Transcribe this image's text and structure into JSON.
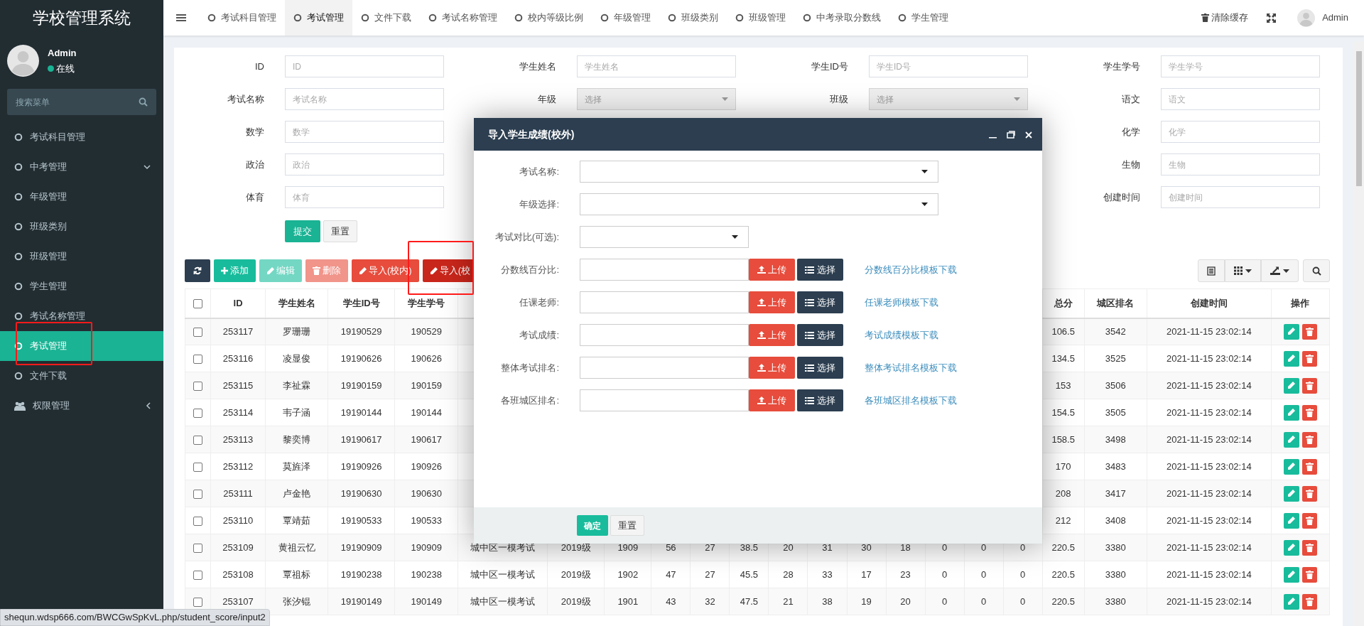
{
  "sidebar": {
    "title": "学校管理系统",
    "user": {
      "name": "Admin",
      "status": "在线",
      "online": true
    },
    "search": {
      "placeholder": "搜索菜单"
    },
    "items": [
      {
        "label": "考试科目管理",
        "kind": "page",
        "selected": false
      },
      {
        "label": "中考管理",
        "kind": "page",
        "selected": false,
        "expanded": true
      },
      {
        "label": "年级管理",
        "kind": "page",
        "selected": false
      },
      {
        "label": "班级类别",
        "kind": "page",
        "selected": false
      },
      {
        "label": "班级管理",
        "kind": "page",
        "selected": false
      },
      {
        "label": "学生管理",
        "kind": "page",
        "selected": false
      },
      {
        "label": "考试名称管理",
        "kind": "page",
        "selected": false
      },
      {
        "label": "考试管理",
        "kind": "page",
        "selected": true
      },
      {
        "label": "文件下载",
        "kind": "page",
        "selected": false
      },
      {
        "label": "权限管理",
        "kind": "module",
        "selected": false,
        "expanded": false
      }
    ]
  },
  "tabs": [
    {
      "label": "考试科目管理",
      "selected": false
    },
    {
      "label": "考试管理",
      "selected": true
    },
    {
      "label": "文件下载",
      "selected": false
    },
    {
      "label": "考试名称管理",
      "selected": false
    },
    {
      "label": "校内等级比例",
      "selected": false
    },
    {
      "label": "年级管理",
      "selected": false
    },
    {
      "label": "班级类别",
      "selected": false
    },
    {
      "label": "班级管理",
      "selected": false
    },
    {
      "label": "中考录取分数线",
      "selected": false
    },
    {
      "label": "学生管理",
      "selected": false
    }
  ],
  "header_right": {
    "clear_cache": "清除缓存",
    "user": "Admin"
  },
  "filter": {
    "rows": [
      [
        {
          "label": "ID",
          "placeholder": "ID",
          "kind": "text"
        },
        {
          "label": "学生姓名",
          "placeholder": "学生姓名",
          "kind": "text"
        },
        {
          "label": "学生ID号",
          "placeholder": "学生ID号",
          "kind": "text"
        },
        {
          "label": "学生学号",
          "placeholder": "学生学号",
          "kind": "text"
        }
      ],
      [
        {
          "label": "考试名称",
          "placeholder": "考试名称",
          "kind": "text"
        },
        {
          "label": "年级",
          "placeholder": "选择",
          "kind": "select"
        },
        {
          "label": "班级",
          "placeholder": "选择",
          "kind": "select"
        },
        {
          "label": "语文",
          "placeholder": "语文",
          "kind": "text"
        }
      ],
      [
        {
          "label": "数学",
          "placeholder": "数学",
          "kind": "text"
        },
        null,
        null,
        {
          "label": "化学",
          "placeholder": "化学",
          "kind": "text"
        }
      ],
      [
        {
          "label": "政治",
          "placeholder": "政治",
          "kind": "text"
        },
        null,
        null,
        {
          "label": "生物",
          "placeholder": "生物",
          "kind": "text"
        }
      ],
      [
        {
          "label": "体育",
          "placeholder": "体育",
          "kind": "text"
        },
        null,
        null,
        {
          "label": "创建时间",
          "placeholder": "创建时间",
          "kind": "text"
        }
      ]
    ],
    "submit": "提交",
    "reset": "重置"
  },
  "toolbar": [
    {
      "kind": "refresh",
      "disabled": false
    },
    {
      "kind": "add",
      "label": "添加",
      "disabled": false
    },
    {
      "kind": "edit",
      "label": "编辑",
      "disabled": true
    },
    {
      "kind": "delete",
      "label": "删除",
      "disabled": true
    },
    {
      "kind": "import",
      "label": "导入(校内)",
      "disabled": false,
      "active": false
    },
    {
      "kind": "import",
      "label": "导入(校",
      "disabled": false,
      "active": true
    }
  ],
  "table": {
    "all_checked": false,
    "columns": [
      "ID",
      "学生姓名",
      "学生ID号",
      "学生学号"
    ],
    "end_columns": [
      "总分",
      "城区排名",
      "创建时间",
      "操作"
    ],
    "rows": [
      {
        "checked": false,
        "cells": [
          "253117",
          "罗珊珊",
          "19190529",
          "190529"
        ],
        "end": [
          "106.5",
          "3542",
          "2021-11-15 23:02:14"
        ]
      },
      {
        "checked": false,
        "cells": [
          "253116",
          "凌显俊",
          "19190626",
          "190626"
        ],
        "end": [
          "134.5",
          "3525",
          "2021-11-15 23:02:14"
        ]
      },
      {
        "checked": false,
        "cells": [
          "253115",
          "李祉霖",
          "19190159",
          "190159"
        ],
        "end": [
          "153",
          "3506",
          "2021-11-15 23:02:14"
        ]
      },
      {
        "checked": false,
        "cells": [
          "253114",
          "韦子涵",
          "19190144",
          "190144"
        ],
        "end": [
          "154.5",
          "3505",
          "2021-11-15 23:02:14"
        ]
      },
      {
        "checked": false,
        "cells": [
          "253113",
          "黎奕博",
          "19190617",
          "190617"
        ],
        "end": [
          "158.5",
          "3498",
          "2021-11-15 23:02:14"
        ]
      },
      {
        "checked": false,
        "cells": [
          "253112",
          "莫旌泽",
          "19190926",
          "190926"
        ],
        "end": [
          "170",
          "3483",
          "2021-11-15 23:02:14"
        ]
      },
      {
        "checked": false,
        "cells": [
          "253111",
          "卢金艳",
          "19190630",
          "190630"
        ],
        "end": [
          "208",
          "3417",
          "2021-11-15 23:02:14"
        ]
      },
      {
        "checked": false,
        "cells": [
          "253110",
          "覃靖茹",
          "19190533",
          "190533"
        ],
        "end": [
          "212",
          "3408",
          "2021-11-15 23:02:14"
        ]
      },
      {
        "checked": false,
        "cells": [
          "253109",
          "黄祖云忆",
          "19190909",
          "190909"
        ],
        "middle": [
          "城中区一模考试",
          "2019级",
          "1909",
          "56",
          "27",
          "38.5",
          "20",
          "31",
          "30",
          "18",
          "0",
          "0",
          "0"
        ],
        "end": [
          "220.5",
          "3380",
          "2021-11-15 23:02:14"
        ]
      },
      {
        "checked": false,
        "cells": [
          "253108",
          "覃祖标",
          "19190238",
          "190238"
        ],
        "middle": [
          "城中区一模考试",
          "2019级",
          "1902",
          "47",
          "27",
          "45.5",
          "28",
          "33",
          "17",
          "23",
          "0",
          "0",
          "0"
        ],
        "end": [
          "220.5",
          "3380",
          "2021-11-15 23:02:14"
        ]
      },
      {
        "checked": false,
        "cells": [
          "253107",
          "张汐锟",
          "19190149",
          "190149"
        ],
        "middle": [
          "城中区一模考试",
          "2019级",
          "1901",
          "43",
          "32",
          "47.5",
          "21",
          "38",
          "19",
          "20",
          "0",
          "0",
          "0"
        ],
        "end": [
          "220.5",
          "3380",
          "2021-11-15 23:02:14"
        ]
      }
    ]
  },
  "modal": {
    "title": "导入学生成绩(校外)",
    "fields": [
      {
        "label": "考试名称:",
        "kind": "select"
      },
      {
        "label": "年级选择:",
        "kind": "select"
      },
      {
        "label": "考试对比(可选):",
        "kind": "select-short"
      },
      {
        "label": "分数线百分比:",
        "kind": "file",
        "upload": "上传",
        "choose": "选择",
        "link": "分数线百分比模板下载"
      },
      {
        "label": "任课老师:",
        "kind": "file",
        "upload": "上传",
        "choose": "选择",
        "link": "任课老师模板下载"
      },
      {
        "label": "考试成绩:",
        "kind": "file",
        "upload": "上传",
        "choose": "选择",
        "link": "考试成绩模板下载"
      },
      {
        "label": "整体考试排名:",
        "kind": "file",
        "upload": "上传",
        "choose": "选择",
        "link": "整体考试排名模板下载"
      },
      {
        "label": "各班城区排名:",
        "kind": "file",
        "upload": "上传",
        "choose": "选择",
        "link": "各班城区排名模板下载"
      }
    ],
    "confirm": "确定",
    "reset": "重置"
  },
  "status_bar": {
    "url": "shequn.wdsp666.com/BWCGwSpKvL.php/student_score/input2"
  }
}
